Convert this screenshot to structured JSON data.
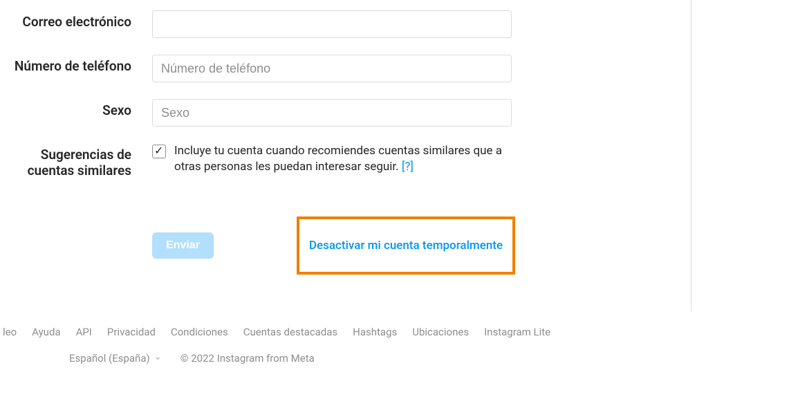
{
  "form": {
    "email": {
      "label": "Correo electrónico",
      "value": "",
      "placeholder": ""
    },
    "phone": {
      "label": "Número de teléfono",
      "value": "",
      "placeholder": "Número de teléfono"
    },
    "gender": {
      "label": "Sexo",
      "value": "",
      "placeholder": "Sexo"
    },
    "suggestions": {
      "label": "Sugerencias de cuentas similares",
      "checked": true,
      "description": "Incluye tu cuenta cuando recomiendes cuentas similares que a otras personas les puedan interesar seguir.",
      "help": "[?]"
    },
    "submit_label": "Enviar",
    "deactivate_label": "Desactivar mi cuenta temporalmente"
  },
  "footer": {
    "links": [
      "leo",
      "Ayuda",
      "API",
      "Privacidad",
      "Condiciones",
      "Cuentas destacadas",
      "Hashtags",
      "Ubicaciones",
      "Instagram Lite"
    ],
    "language": "Español (España)",
    "copyright": "© 2022 Instagram from Meta"
  }
}
